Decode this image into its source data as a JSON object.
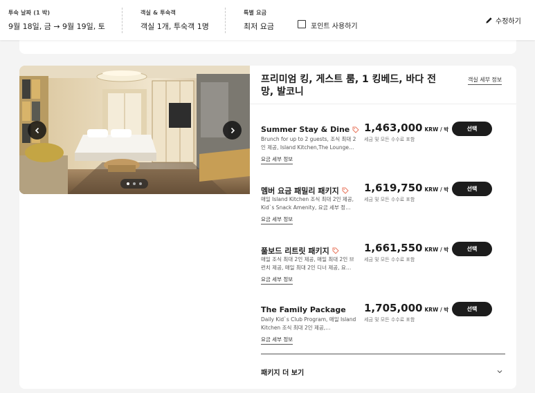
{
  "header": {
    "stay_dates_label": "투숙 날짜 (1 박)",
    "stay_dates_value": "9월 18일, 금 → 9월 19일, 토",
    "rooms_guests_label": "객실 & 투숙객",
    "rooms_guests_value": "객실 1개, 투숙객 1명",
    "special_rate_label": "특별 요금",
    "special_rate_value": "최저 요금",
    "use_points_label": "포인트 사용하기",
    "edit_label": "수정하기"
  },
  "room": {
    "title": "프리미엄 킹, 게스트 룸, 1 킹베드, 바다 전망, 발코니",
    "details_link": "객실 세부 정보",
    "photo_count": 3,
    "photo_index": 1
  },
  "rates": [
    {
      "name": "Summer Stay & Dine",
      "description": "Brunch for up to 2 guests, 조식 최대 2인 제공, Island Kitchen,The Lounge…",
      "link": "요금 세부 정보",
      "price": "1,463,000",
      "unit": "KRW / 박",
      "note": "세금 및 모든 수수료 포함",
      "select_label": "선택",
      "tagged": true
    },
    {
      "name": "멤버 요금 패밀리 패키지",
      "description": "매일 Island Kitchen 조식 최대 2인 제공, Kid`s Snack Amenity, 요금 세부 정…",
      "link": "요금 세부 정보",
      "price": "1,619,750",
      "unit": "KRW / 박",
      "note": "세금 및 모든 수수료 포함",
      "select_label": "선택",
      "tagged": true
    },
    {
      "name": "풀보드 리트릿 패키지",
      "description": "매일 조식 최대 2인 제공, 매일 최대 2인 브런치 제공, 매일 최대 2인 디너 제공, 요…",
      "link": "요금 세부 정보",
      "price": "1,661,550",
      "unit": "KRW / 박",
      "note": "세금 및 모든 수수료 포함",
      "select_label": "선택",
      "tagged": true
    },
    {
      "name": "The Family Package",
      "description": "Daily Kid`s Club Program, 매일 Island Kitchen 조식 최대 2인 제공,…",
      "link": "요금 세부 정보",
      "price": "1,705,000",
      "unit": "KRW / 박",
      "note": "세금 및 모든 수수료 포함",
      "select_label": "선택",
      "tagged": false
    }
  ],
  "more_packages_label": "패키지 더 보기",
  "colors": {
    "accent": "#e8765c",
    "button": "#1c1c1c",
    "page_bg": "#f4f4f4"
  }
}
